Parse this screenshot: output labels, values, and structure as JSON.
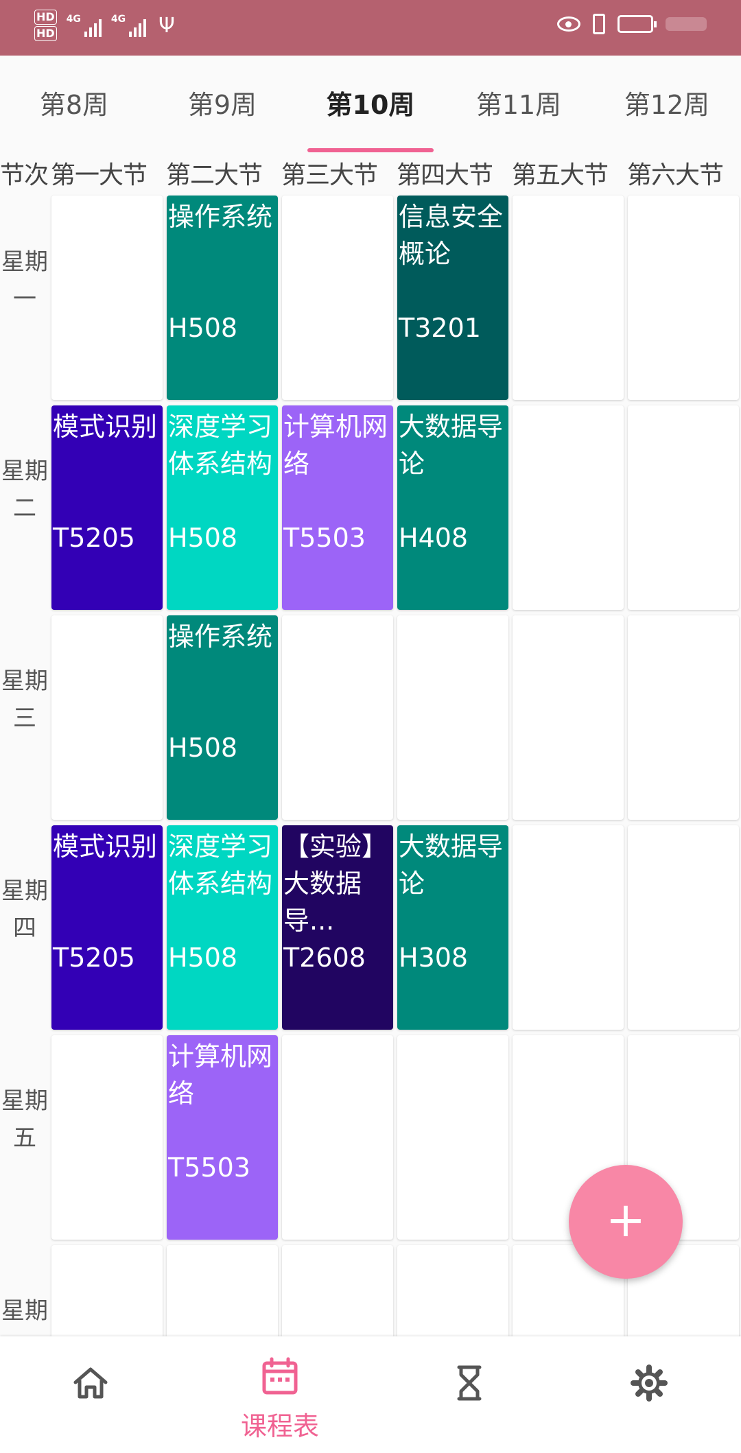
{
  "status_bar": {
    "hd1": "HD",
    "hd2": "HD",
    "net1": "4G",
    "net2": "4G"
  },
  "weeks": [
    {
      "label": "第8周"
    },
    {
      "label": "第9周"
    },
    {
      "label": "第10周",
      "active": true
    },
    {
      "label": "第11周"
    },
    {
      "label": "第12周"
    }
  ],
  "periods_corner": "节次",
  "periods": [
    "第一大节",
    "第二大节",
    "第三大节",
    "第四大节",
    "第五大节",
    "第六大节"
  ],
  "days": [
    "星期一",
    "星期二",
    "星期三",
    "星期四",
    "星期五",
    "星期"
  ],
  "schedule": [
    [
      null,
      {
        "name": "操作系统",
        "room": "H508",
        "color": "#00897b"
      },
      null,
      {
        "name": "信息安全概论",
        "room": "T3201",
        "color": "#005b5b"
      },
      null,
      null
    ],
    [
      {
        "name": "模式识别",
        "room": "T5205",
        "color": "#3300b5"
      },
      {
        "name": "深度学习体系结构",
        "room": "H508",
        "color": "#00d7c2"
      },
      {
        "name": "计算机网络",
        "room": "T5503",
        "color": "#9c64f7"
      },
      {
        "name": "大数据导论",
        "room": "H408",
        "color": "#00897b"
      },
      null,
      null
    ],
    [
      null,
      {
        "name": "操作系统",
        "room": "H508",
        "color": "#00897b"
      },
      null,
      null,
      null,
      null
    ],
    [
      {
        "name": "模式识别",
        "room": "T5205",
        "color": "#3300b5"
      },
      {
        "name": "深度学习体系结构",
        "room": "H508",
        "color": "#00d7c2"
      },
      {
        "name": "【实验】大数据导...",
        "room": "T2608",
        "color": "#210561"
      },
      {
        "name": "大数据导论",
        "room": "H308",
        "color": "#00897b"
      },
      null,
      null
    ],
    [
      null,
      {
        "name": "计算机网络",
        "room": "T5503",
        "color": "#9c64f7"
      },
      null,
      null,
      null,
      null
    ],
    [
      null,
      null,
      null,
      null,
      null,
      null
    ]
  ],
  "fab": {
    "label": "+"
  },
  "bottom_nav": {
    "home_icon": "home-icon",
    "schedule_icon": "calendar-icon",
    "schedule_label": "课程表",
    "timer_icon": "hourglass-icon",
    "settings_icon": "gear-icon"
  },
  "colors": {
    "status_bar": "#b5616f",
    "accent": "#f06292",
    "fab": "#f887a6"
  }
}
